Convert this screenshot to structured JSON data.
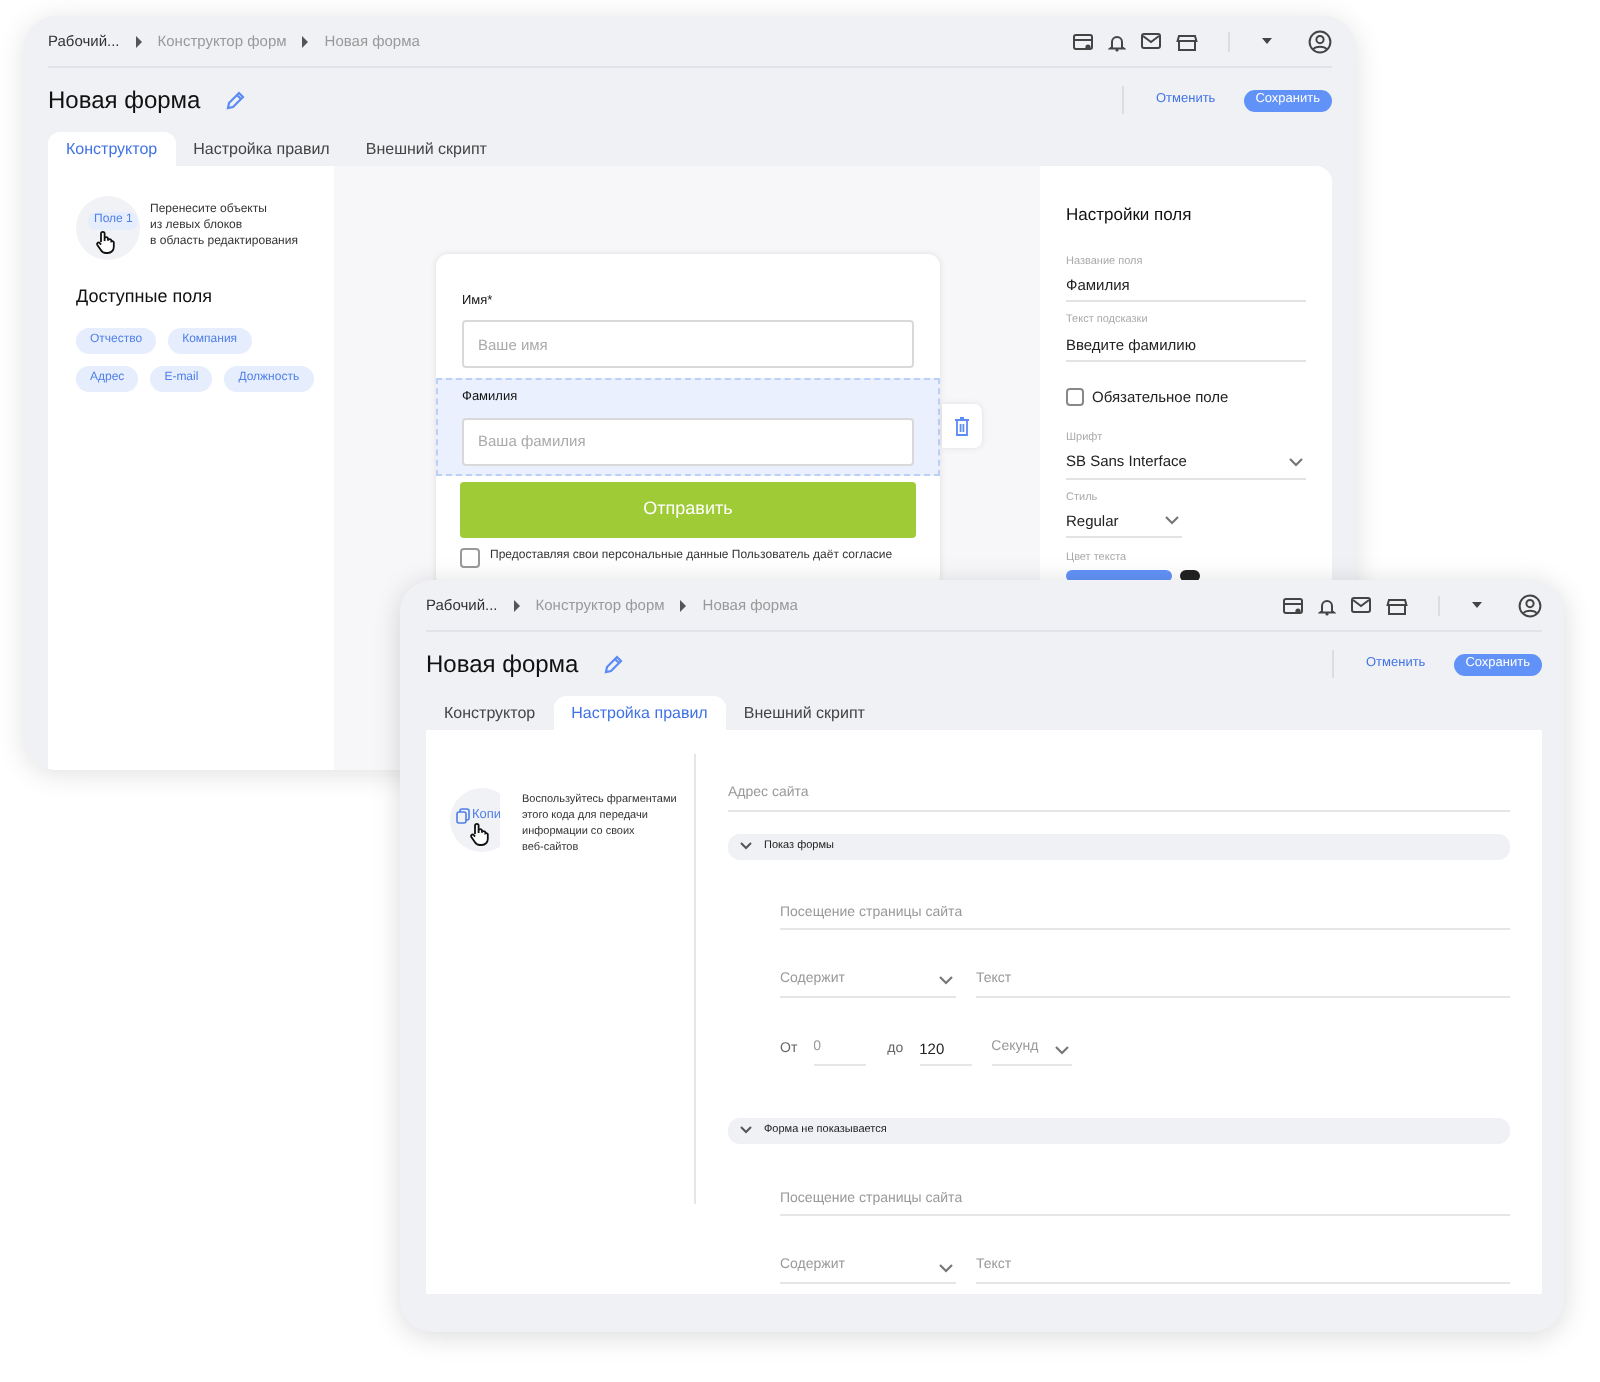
{
  "back_window": {
    "header": {
      "breadcrumb": [
        "Рабочий...",
        "Конструктор форм",
        "Новая форма"
      ],
      "title": "Новая форма",
      "cancel": "Отменить",
      "save": "Сохранить",
      "tabs": [
        {
          "label": "Конструктор",
          "selected": true
        },
        {
          "label": "Настройка правил",
          "selected": false
        },
        {
          "label": "Внешний скрипт",
          "selected": false
        }
      ]
    },
    "left_panel": {
      "chip": "Поле 1",
      "hint": "Перенесите объекты\nиз левых блоков\nв область редактирования",
      "title": "Доступные поля",
      "fields": [
        "Отчество",
        "Компания",
        "Адрес",
        "E-mail",
        "Должность"
      ]
    },
    "form": {
      "fields": [
        {
          "label": "Имя*",
          "placeholder": "Ваше имя",
          "selected": false
        },
        {
          "label": "Фамилия",
          "placeholder": "Ваша фамилия",
          "selected": true
        }
      ],
      "submit": "Отправить",
      "consent": {
        "text": "Предоставляя свои персональные данные Пользователь даёт согласие",
        "checked": false
      }
    },
    "settings": {
      "title": "Настройки поля",
      "name": {
        "label": "Название поля",
        "value": "Фамилия"
      },
      "hint": {
        "label": "Текст подсказки",
        "value": "Введите фамилию"
      },
      "required": {
        "label": "Обязательное поле",
        "checked": false
      },
      "font": {
        "label": "Шрифт",
        "value": "SB Sans Interface"
      },
      "style": {
        "label": "Стиль",
        "value": "Regular"
      },
      "color": {
        "label": "Цвет текста"
      }
    }
  },
  "front_window": {
    "header": {
      "breadcrumb": [
        "Рабочий...",
        "Конструктор форм",
        "Новая форма"
      ],
      "title": "Новая форма",
      "cancel": "Отменить",
      "save": "Сохранить",
      "tabs": [
        {
          "label": "Конструктор",
          "selected": false
        },
        {
          "label": "Настройка правил",
          "selected": true
        },
        {
          "label": "Внешний скрипт",
          "selected": false
        }
      ]
    },
    "left_panel": {
      "chip": "Копи",
      "hint": "Воспользуйтесь фрагментами\nэтого кода для передачи\nинформации со своих\nвеб-сайтов"
    },
    "address": {
      "placeholder": "Адрес сайта"
    },
    "sections": [
      {
        "title": "Показ формы",
        "expanded": true,
        "rows": [
          {
            "kind": "field",
            "placeholder": "Посещение страницы сайта"
          },
          {
            "kind": "condition",
            "select": "Содержит",
            "placeholder": "Текст"
          },
          {
            "kind": "range",
            "from_label": "От",
            "from_value": "0",
            "to_label": "до",
            "to_value": "120",
            "unit": "Секунд"
          }
        ]
      },
      {
        "title": "Форма не показывается",
        "expanded": true,
        "rows": [
          {
            "kind": "field",
            "placeholder": "Посещение страницы сайта"
          },
          {
            "kind": "condition",
            "select": "Содержит",
            "placeholder": "Текст"
          }
        ]
      }
    ]
  }
}
